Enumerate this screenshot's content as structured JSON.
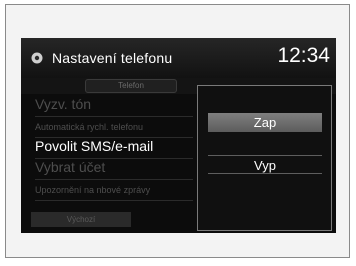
{
  "header": {
    "title": "Nastavení telefonu",
    "clock": "12:34",
    "icon": "gear-icon"
  },
  "tab": {
    "label": "Telefon"
  },
  "menu": {
    "items": [
      {
        "label": "Vyzv. tón"
      },
      {
        "label": "Automatická rychl. telefonu"
      },
      {
        "label": "Povolit SMS/e-mail"
      },
      {
        "label": "Vybrat účet"
      },
      {
        "label": "Upozornění na nbové zprávy"
      }
    ],
    "selected_index": 2
  },
  "footer": {
    "button_label": "Výchozí"
  },
  "popup": {
    "options": [
      {
        "label": "Zap",
        "highlighted": true
      },
      {
        "label": "Vyp",
        "highlighted": false
      }
    ]
  }
}
